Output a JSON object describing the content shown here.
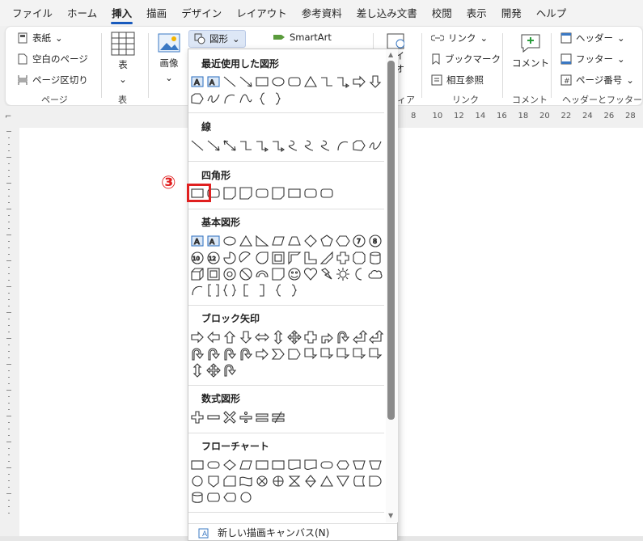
{
  "tabs": [
    "ファイル",
    "ホーム",
    "挿入",
    "描画",
    "デザイン",
    "レイアウト",
    "参考資料",
    "差し込み文書",
    "校閲",
    "表示",
    "開発",
    "ヘルプ"
  ],
  "active_tab": "挿入",
  "ribbon": {
    "pages": {
      "cover": "表紙",
      "blank": "空白のページ",
      "break": "ページ区切り",
      "group": "ページ"
    },
    "table": {
      "label": "表",
      "group": "表"
    },
    "illust": {
      "image": "画像",
      "shapes": "図形",
      "smartart": "SmartArt"
    },
    "media": {
      "l1": "ライ",
      "l2": "デオ",
      "group": "ィア"
    },
    "links": {
      "link": "リンク",
      "bookmark": "ブックマーク",
      "crossref": "相互参照",
      "group": "リンク"
    },
    "comment": {
      "label": "コメント",
      "group": "コメント"
    },
    "hf": {
      "header": "ヘッダー",
      "footer": "フッター",
      "pagenum": "ページ番号",
      "group": "ヘッダーとフッター"
    }
  },
  "ruler_ticks": [
    "8",
    "10",
    "12",
    "14",
    "16",
    "18",
    "20",
    "22",
    "24",
    "26",
    "28"
  ],
  "menu": {
    "sections": {
      "recent": "最近使用した図形",
      "lines": "線",
      "rect": "四角形",
      "basic": "基本図形",
      "arrows": "ブロック矢印",
      "equation": "数式図形",
      "flow": "フローチャート"
    },
    "new_canvas": "新しい描画キャンバス(N)",
    "step": "③"
  },
  "colors": {
    "accent": "#185abd",
    "highlight": "#e02020"
  }
}
